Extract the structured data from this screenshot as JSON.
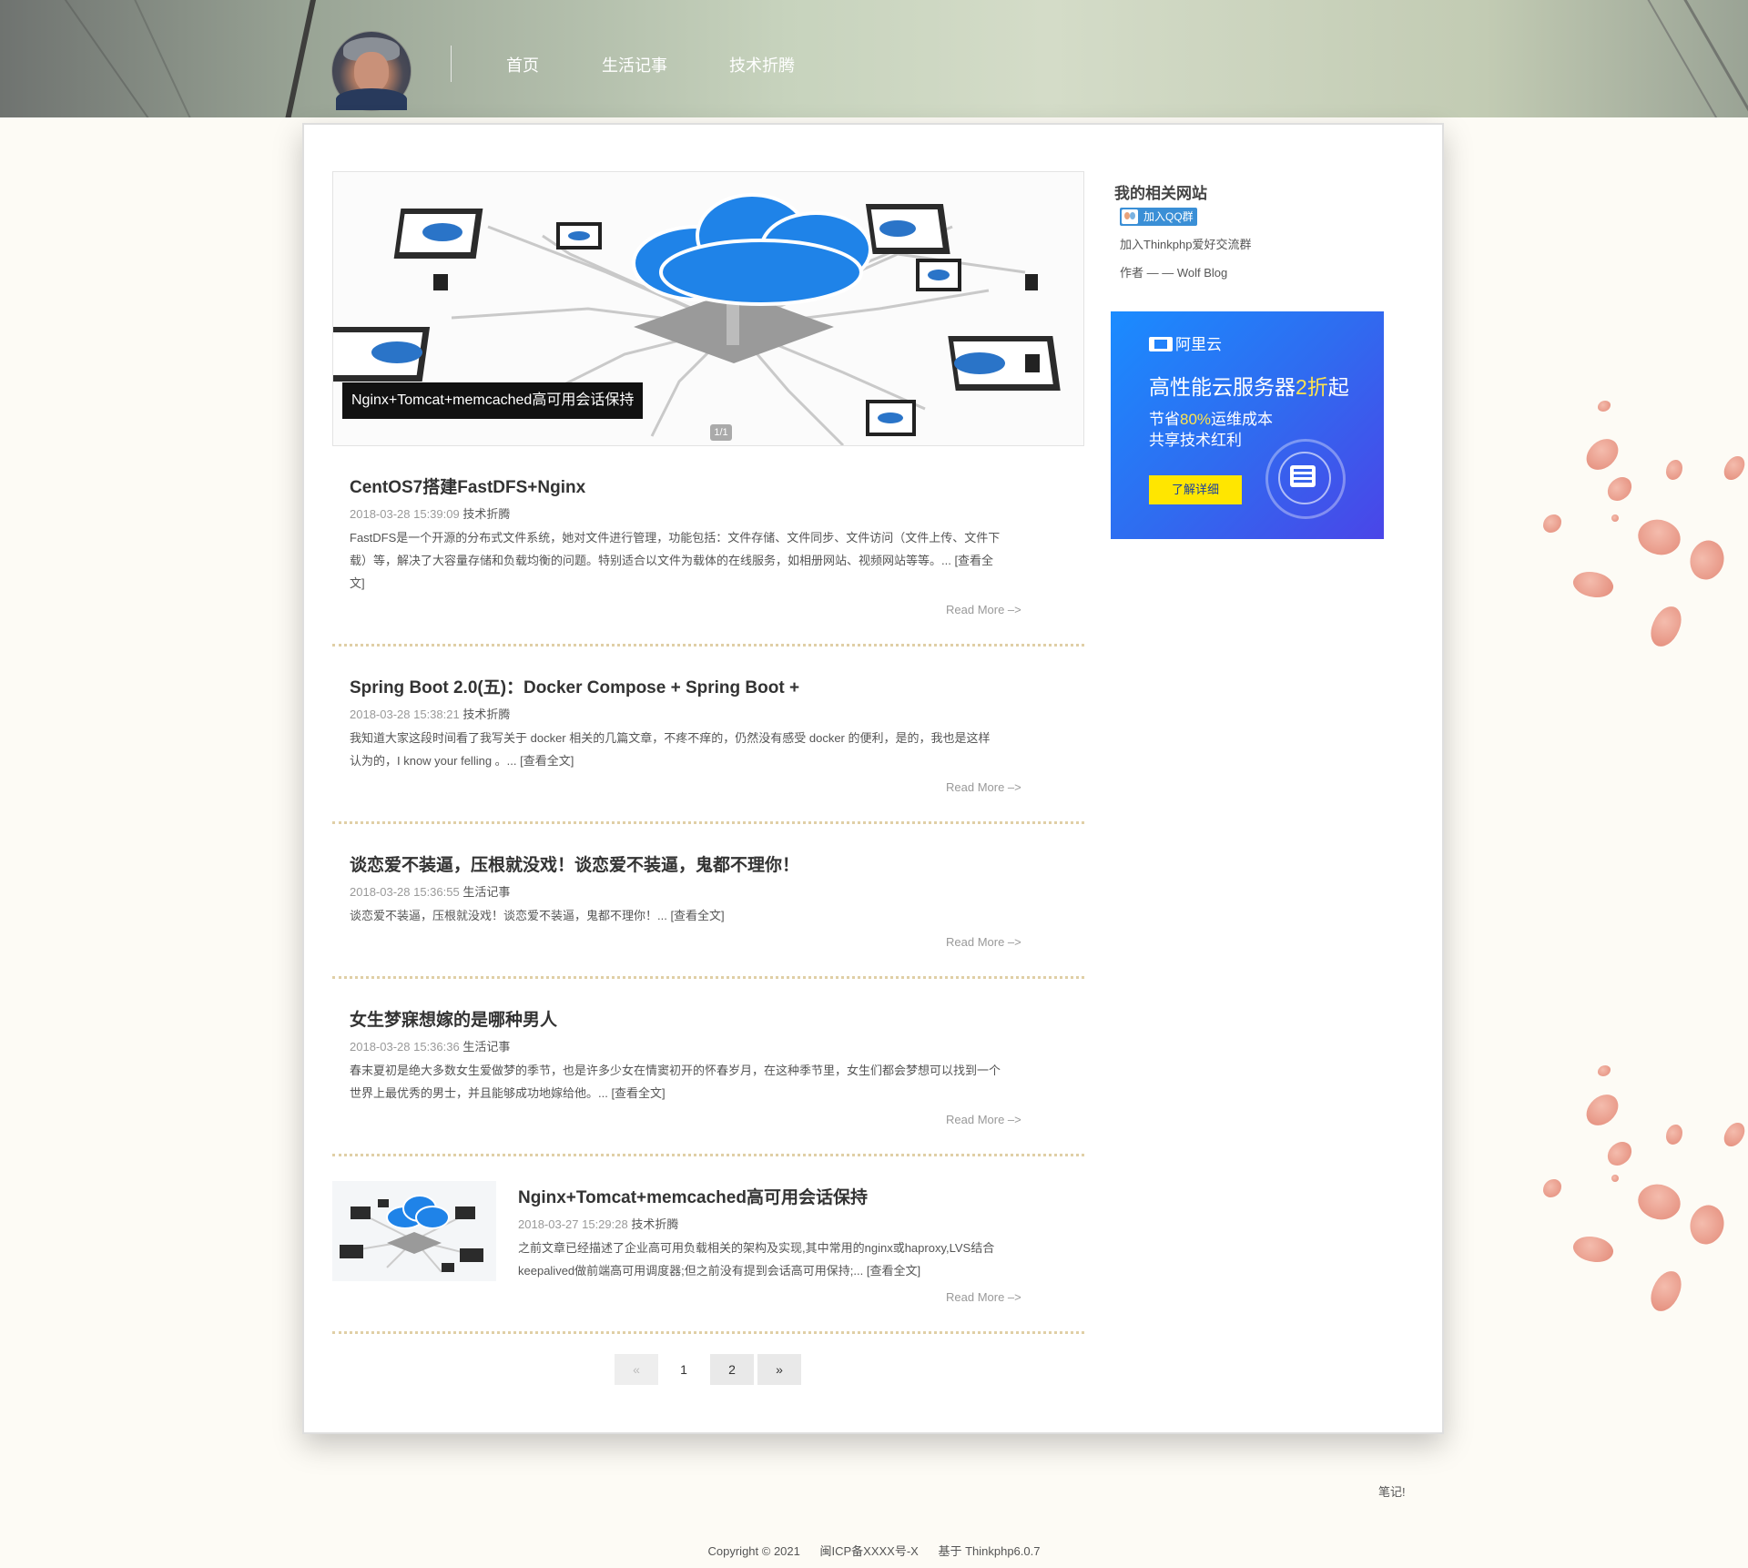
{
  "header": {
    "nav": [
      {
        "label": "首页"
      },
      {
        "label": "生活记事"
      },
      {
        "label": "技术折腾"
      }
    ]
  },
  "slider": {
    "caption": "Nginx+Tomcat+memcached高可用会话保持",
    "counter": "1/1"
  },
  "posts": [
    {
      "title": "CentOS7搭建FastDFS+Nginx",
      "date": "2018-03-28 15:39:09",
      "category": "技术折腾",
      "summary_lines": [
        "FastDFS是一个开源的分布式文件系统，她对文件进行管理，功能包括：文件存储、文件同步、文件访问（文件上传、文件下",
        "载）等，解决了大容量存储和负载均衡的问题。特别适合以文件为载体的在线服务，如相册网站、视频网站等等。... [查看全",
        "文]"
      ],
      "read_more": "Read More –>"
    },
    {
      "title": "Spring Boot 2.0(五)：Docker Compose + Spring Boot +",
      "date": "2018-03-28 15:38:21",
      "category": "技术折腾",
      "summary_lines": [
        "我知道大家这段时间看了我写关于 docker 相关的几篇文章，不疼不痒的，仍然没有感受 docker 的便利，是的，我也是这样",
        "认为的，I know your felling 。... [查看全文]"
      ],
      "read_more": "Read More –>"
    },
    {
      "title": "谈恋爱不装逼，压根就没戏！谈恋爱不装逼，鬼都不理你！",
      "date": "2018-03-28 15:36:55",
      "category": "生活记事",
      "summary_lines": [
        "谈恋爱不装逼，压根就没戏！谈恋爱不装逼，鬼都不理你！... [查看全文]"
      ],
      "read_more": "Read More –>"
    },
    {
      "title": "女生梦寐想嫁的是哪种男人",
      "date": "2018-03-28 15:36:36",
      "category": "生活记事",
      "summary_lines": [
        "春末夏初是绝大多数女生爱做梦的季节，也是许多少女在情窦初开的怀春岁月，在这种季节里，女生们都会梦想可以找到一个",
        "世界上最优秀的男士，并且能够成功地嫁给他。... [查看全文]"
      ],
      "read_more": "Read More –>"
    },
    {
      "title": "Nginx+Tomcat+memcached高可用会话保持",
      "date": "2018-03-27 15:29:28",
      "category": "技术折腾",
      "summary_lines": [
        "之前文章已经描述了企业高可用负载相关的架构及实现,其中常用的nginx或haproxy,LVS结合",
        "keepalived做前端高可用调度器;但之前没有提到会话高可用保持;... [查看全文]"
      ],
      "read_more": "Read More –>"
    }
  ],
  "pagination": {
    "prev": "«",
    "pages": [
      "1",
      "2"
    ],
    "next": "»",
    "current": "1"
  },
  "sidebar": {
    "title": "我的相关网站",
    "qq_badge": "加入QQ群",
    "qq_text": "加入Thinkphp爱好交流群",
    "author_text": "作者 — — Wolf Blog",
    "ad": {
      "brand": "阿里云",
      "headline_a": "高性能云服务器",
      "headline_b": "2折",
      "headline_c": "起",
      "line2_a": "节省",
      "line2_b": "80%",
      "line2_c": "运维成本",
      "line3": "共享技术红利",
      "button": "了解详细"
    }
  },
  "note": "笔记!",
  "footer": {
    "copyright": "Copyright © 2021",
    "icp": "闽ICP备XXXX号-X",
    "powered": "基于 Thinkphp6.0.7"
  }
}
